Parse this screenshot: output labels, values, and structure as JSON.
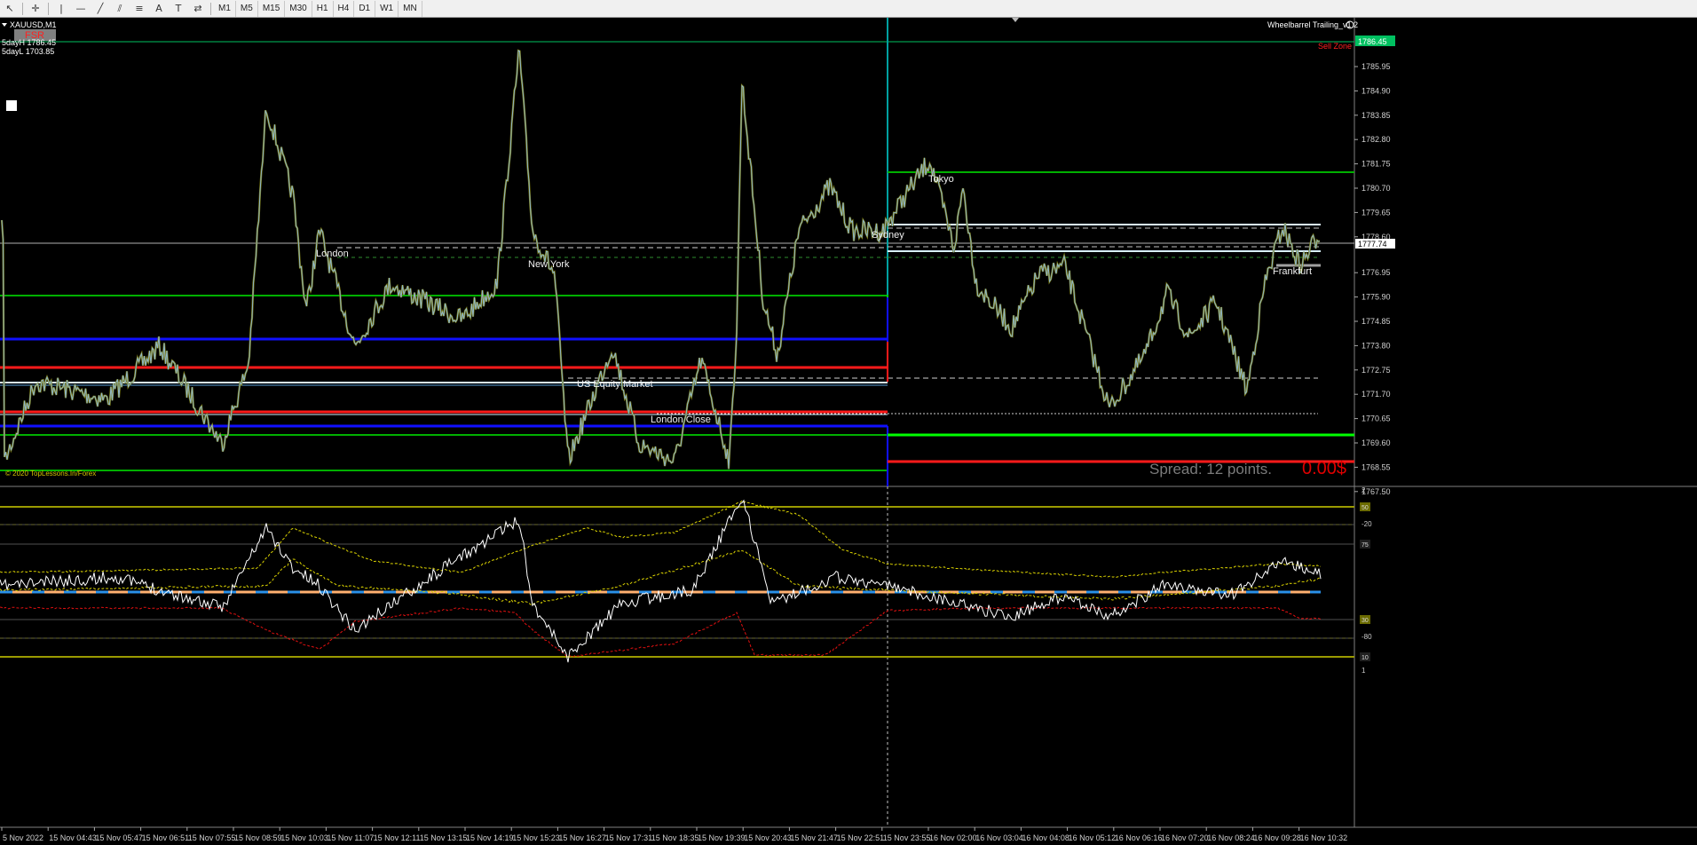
{
  "toolbar": {
    "tools": [
      {
        "icon": "cursor-arrow-icon",
        "glyph": "↖"
      },
      {
        "icon": "crosshair-icon",
        "glyph": "✛"
      },
      {
        "icon": "vertical-line-icon",
        "glyph": "|"
      },
      {
        "icon": "horizontal-line-icon",
        "glyph": "—"
      },
      {
        "icon": "trendline-icon",
        "glyph": "╱"
      },
      {
        "icon": "equidistant-channel-icon",
        "glyph": "⫽"
      },
      {
        "icon": "fibonacci-icon",
        "glyph": "≡"
      },
      {
        "icon": "text-icon",
        "glyph": "A"
      },
      {
        "icon": "text-label-icon",
        "glyph": "T"
      },
      {
        "icon": "arrows-icon",
        "glyph": "⇄"
      }
    ],
    "timeframes": [
      "M1",
      "M5",
      "M15",
      "M30",
      "H1",
      "H4",
      "D1",
      "W1",
      "MN"
    ]
  },
  "main": {
    "symbol": "XAUUSD,M1",
    "fsr_label": "FSR",
    "five_day_high": "5dayH 1786.45",
    "five_day_low": "5dayL 1703.85",
    "ea_name": "Wheelbarrel Trailing_v1.2",
    "ea_icon": "smiley-icon",
    "sell_zone": "Sell Zone",
    "copyright": "© 2020 TopLessons.In/Forex",
    "spread": "Spread: 12 points.",
    "profit": "0.00$",
    "current_price": "1777.74",
    "top_level_price": "1786.45",
    "session_labels": [
      "London",
      "New York",
      "US Equity Market",
      "London Close",
      "Sydney",
      "Tokyo",
      "Frankfurt"
    ],
    "price_ticks": [
      "1785.95",
      "1784.90",
      "1783.85",
      "1782.80",
      "1781.75",
      "1780.70",
      "1779.65",
      "1778.60",
      "1776.95",
      "1775.90",
      "1774.85",
      "1773.80",
      "1772.75",
      "1771.70",
      "1770.65",
      "1769.60",
      "1768.55",
      "1767.50"
    ]
  },
  "indicator": {
    "ticks": [
      "2",
      "-20",
      "-80",
      "1"
    ],
    "level_labels": [
      "50",
      "75",
      "30",
      "10"
    ]
  },
  "time_axis": [
    "5 Nov 2022",
    "15 Nov 04:43",
    "15 Nov 05:47",
    "15 Nov 06:51",
    "15 Nov 07:55",
    "15 Nov 08:59",
    "15 Nov 10:03",
    "15 Nov 11:07",
    "15 Nov 12:11",
    "15 Nov 13:15",
    "15 Nov 14:19",
    "15 Nov 15:23",
    "15 Nov 16:27",
    "15 Nov 17:31",
    "15 Nov 18:35",
    "15 Nov 19:39",
    "15 Nov 20:43",
    "15 Nov 21:47",
    "15 Nov 22:51",
    "15 Nov 23:55",
    "16 Nov 02:00",
    "16 Nov 03:04",
    "16 Nov 04:08",
    "16 Nov 05:12",
    "16 Nov 06:16",
    "16 Nov 07:20",
    "16 Nov 08:24",
    "16 Nov 09:28",
    "16 Nov 10:32"
  ],
  "colors": {
    "background": "#000000",
    "candles": "#8fb6c9",
    "green_level": "#00b000",
    "bright_green": "#00ff00",
    "red_level": "#ff1a1a",
    "blue_level": "#1010ff",
    "white_level": "#d8f0ff",
    "profit_red": "#e00000",
    "sell_zone_red": "#ff2020",
    "olive": "#8a8a00"
  }
}
